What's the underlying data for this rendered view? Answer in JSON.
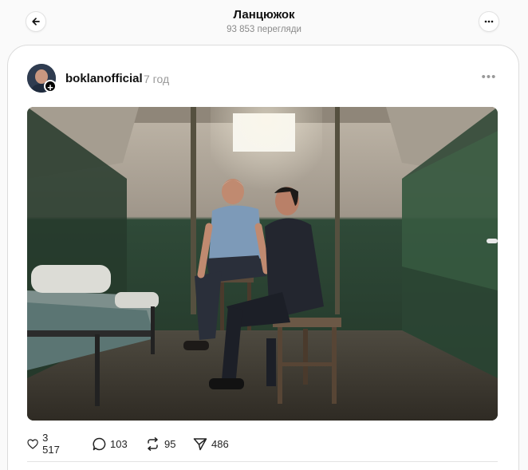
{
  "header": {
    "title": "Ланцюжок",
    "subtitle": "93 853 перегляди"
  },
  "post": {
    "username": "boklanofficial",
    "time": "7 год",
    "image_alt": "Two men sitting on stools in a prison cell",
    "stats": {
      "likes": "3 517",
      "replies": "103",
      "reposts": "95",
      "shares": "486"
    }
  },
  "icons": {
    "back": "arrow-left-icon",
    "more": "more-horizontal-icon",
    "like": "heart-icon",
    "reply": "speech-bubble-icon",
    "repost": "repost-icon",
    "share": "send-icon",
    "follow": "plus-icon"
  },
  "colors": {
    "background": "#fafafa",
    "card": "#ffffff",
    "muted_text": "#999999"
  }
}
